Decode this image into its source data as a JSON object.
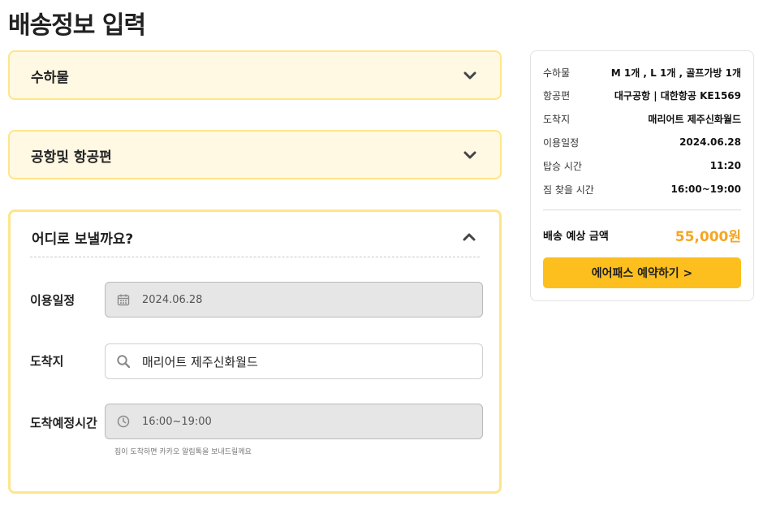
{
  "page": {
    "title": "배송정보 입력"
  },
  "sections": {
    "luggage": {
      "title": "수하물",
      "expanded": false
    },
    "airport_flight": {
      "title": "공항및 항공편",
      "expanded": false
    },
    "destination": {
      "title": "어디로 보낼까요?",
      "expanded": true,
      "fields": {
        "date": {
          "label": "이용일정",
          "value": "2024.06.28",
          "icon": "calendar-icon"
        },
        "arrival": {
          "label": "도착지",
          "value": "매리어트 제주신화월드",
          "icon": "search-icon"
        },
        "time": {
          "label": "도착예정시간",
          "value": "16:00~19:00",
          "icon": "clock-icon"
        }
      },
      "helper_text": "짐이 도착하면 카카오 알림톡을 보내드릴께요"
    }
  },
  "summary": {
    "rows": [
      {
        "label": "수하물",
        "value": "M 1개 , L 1개 , 골프가방 1개"
      },
      {
        "label": "항공편",
        "value": "대구공항 | 대한항공 KE1569"
      },
      {
        "label": "도착지",
        "value": "매리어트 제주신화월드"
      },
      {
        "label": "이용일정",
        "value": "2024.06.28"
      },
      {
        "label": "탑승 시간",
        "value": "11:20"
      },
      {
        "label": "짐 찾을 시간",
        "value": "16:00~19:00"
      }
    ],
    "total_label": "배송 예상 금액",
    "total_value": "55,000원",
    "cta_label": "에어패스 예약하기 >"
  },
  "colors": {
    "accent": "#fcbf1e",
    "price": "#f5a623",
    "section_bg": "#fff8e3",
    "section_border": "#fde68a"
  }
}
